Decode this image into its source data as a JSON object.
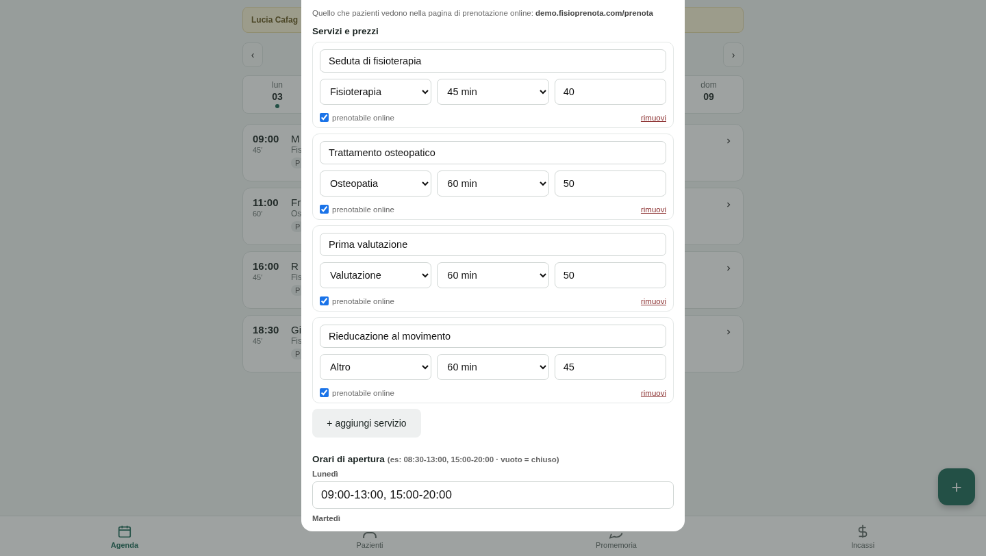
{
  "banner": {
    "text": "Lucia Cafag"
  },
  "week_nav": {
    "prev": "‹",
    "next": "›"
  },
  "days": [
    {
      "weekday": "lun",
      "date": "03",
      "has_appointments": true
    },
    {
      "weekday": "dom",
      "date": "09",
      "has_appointments": false
    }
  ],
  "appointments": [
    {
      "time": "09:00",
      "duration": "45′",
      "name": "M",
      "service": "Fis",
      "tag": "P"
    },
    {
      "time": "11:00",
      "duration": "60′",
      "name": "Fr",
      "service": "Os",
      "tag": "P"
    },
    {
      "time": "16:00",
      "duration": "45′",
      "name": "R",
      "service": "Fis",
      "tag": "P"
    },
    {
      "time": "18:30",
      "duration": "45′",
      "name": "Gi",
      "service": "Fis",
      "tag": "P"
    }
  ],
  "bottom_nav": [
    {
      "label": "Agenda",
      "selected": true
    },
    {
      "label": "Pazienti",
      "selected": false
    },
    {
      "label": "Promemoria",
      "selected": false
    },
    {
      "label": "Incassi",
      "selected": false
    }
  ],
  "fab": {
    "label": "+"
  },
  "modal": {
    "intro": "Quello che pazienti vedono nella pagina di prenotazione online: **demo.fisioprenota.com/prenota**",
    "services_heading": "Servizi e prezzi",
    "services": [
      {
        "name": "Seduta di fisioterapia",
        "category": "Fisioterapia",
        "duration": "45 min",
        "price": "40",
        "online": true,
        "online_label": "prenotabile online",
        "remove": "rimuovi"
      },
      {
        "name": "Trattamento osteopatico",
        "category": "Osteopatia",
        "duration": "60 min",
        "price": "50",
        "online": true,
        "online_label": "prenotabile online",
        "remove": "rimuovi"
      },
      {
        "name": "Prima valutazione",
        "category": "Valutazione",
        "duration": "60 min",
        "price": "50",
        "online": true,
        "online_label": "prenotabile online",
        "remove": "rimuovi"
      },
      {
        "name": "Rieducazione al movimento",
        "category": "Altro",
        "duration": "60 min",
        "price": "45",
        "online": true,
        "online_label": "prenotabile online",
        "remove": "rimuovi"
      }
    ],
    "add_service": "+ aggiungi servizio",
    "hours_heading": "Orari di apertura",
    "hours_hint": "(es: 08:30-13:00, 15:00-20:00 · vuoto = chiuso)",
    "hours": [
      {
        "day": "Lunedì",
        "value": "09:00-13:00, 15:00-20:00"
      },
      {
        "day": "Martedì"
      }
    ]
  }
}
